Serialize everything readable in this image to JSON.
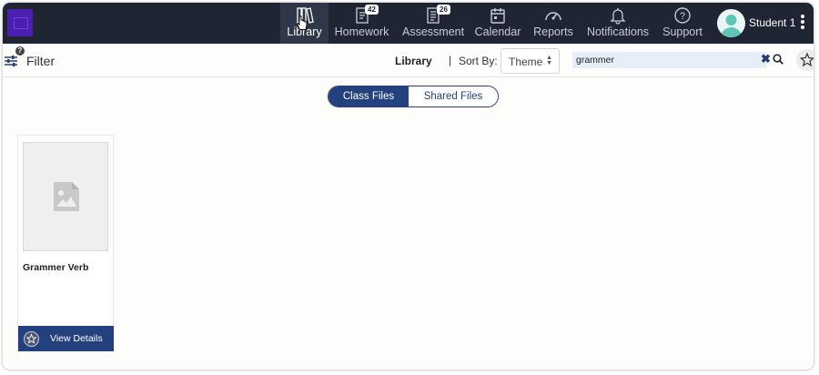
{
  "nav": {
    "items": [
      {
        "label": "Library",
        "badge": ""
      },
      {
        "label": "Homework",
        "badge": "42"
      },
      {
        "label": "Assessment",
        "badge": "26"
      },
      {
        "label": "Calendar",
        "badge": ""
      },
      {
        "label": "Reports",
        "badge": ""
      },
      {
        "label": "Notifications",
        "badge": ""
      },
      {
        "label": "Support",
        "badge": ""
      }
    ],
    "active": "Library",
    "user_name": "Student 1"
  },
  "toolbar": {
    "help": "?",
    "filter_label": "Filter",
    "section_label": "Library",
    "divider": "|",
    "sort_label": "Sort By:",
    "sort_value": "Theme",
    "search_value": "grammer",
    "clear_symbol": "✖"
  },
  "tabs": {
    "class_files": "Class Files",
    "shared_files": "Shared Files",
    "selected": "Class Files"
  },
  "files": [
    {
      "title": "Grammer Verb",
      "button": "View Details"
    }
  ],
  "colors": {
    "nav_bg": "#1f2533",
    "nav_active": "#2f3749",
    "brand_blue": "#24417f",
    "logo": "#4b1fb0"
  }
}
